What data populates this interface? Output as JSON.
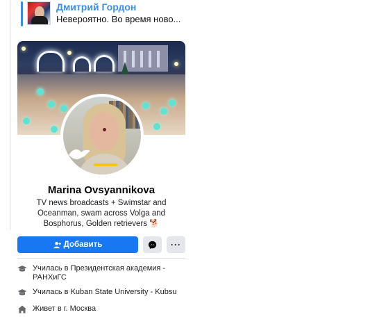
{
  "reply": {
    "author": "Дмитрий Гордон",
    "message": "Невероятно. Во время ново..."
  },
  "profile": {
    "name": "Marina Ovsyannikova",
    "bio": "TV news broadcasts + Swimstar and Oceanman, swam across Volga and Bosphorus, Golden retrievers 🐕"
  },
  "actions": {
    "add_label": "Добавить",
    "add_icon": "add-friend-icon",
    "message_icon": "messenger-icon",
    "more_label": "···"
  },
  "info": [
    {
      "prefix": "Училась в ",
      "value": "Президентская академия - РАНХиГС",
      "icon": "graduation-cap-icon"
    },
    {
      "prefix": "Училась в ",
      "value": "Kuban State University - Kubsu",
      "icon": "graduation-cap-icon"
    },
    {
      "prefix": "Живет в г. ",
      "value": "Москва",
      "icon": "home-icon"
    }
  ],
  "colors": {
    "accent": "#1877f2",
    "telegram_link": "#3a8ee6",
    "button_gray": "#e4e6eb"
  }
}
